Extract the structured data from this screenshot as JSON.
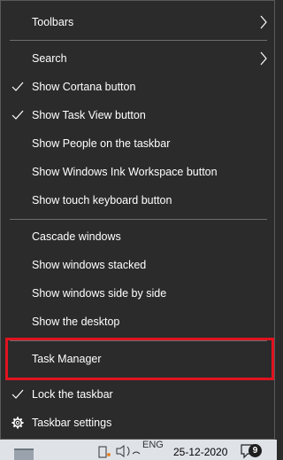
{
  "menu": {
    "items": [
      {
        "label": "Toolbars",
        "checked": false,
        "submenu": true
      },
      {
        "label": "Search",
        "checked": false,
        "submenu": true
      },
      {
        "label": "Show Cortana button",
        "checked": true,
        "submenu": false
      },
      {
        "label": "Show Task View button",
        "checked": true,
        "submenu": false
      },
      {
        "label": "Show People on the taskbar",
        "checked": false,
        "submenu": false
      },
      {
        "label": "Show Windows Ink Workspace button",
        "checked": false,
        "submenu": false
      },
      {
        "label": "Show touch keyboard button",
        "checked": false,
        "submenu": false
      },
      {
        "label": "Cascade windows",
        "checked": false,
        "submenu": false
      },
      {
        "label": "Show windows stacked",
        "checked": false,
        "submenu": false
      },
      {
        "label": "Show windows side by side",
        "checked": false,
        "submenu": false
      },
      {
        "label": "Show the desktop",
        "checked": false,
        "submenu": false
      },
      {
        "label": "Task Manager",
        "checked": false,
        "submenu": false,
        "highlighted": true
      },
      {
        "label": "Lock the taskbar",
        "checked": true,
        "submenu": false
      },
      {
        "label": "Taskbar settings",
        "checked": false,
        "submenu": false,
        "icon": "gear-icon"
      }
    ]
  },
  "taskbar": {
    "language": "ENG",
    "date": "25-12-2020",
    "notification_count": "9"
  },
  "colors": {
    "menu_background": "#2b2b2b",
    "menu_text": "#ffffff",
    "separator": "#6d6d6d",
    "highlight_border": "#e0131f",
    "taskbar_background": "#dfe3e8"
  }
}
